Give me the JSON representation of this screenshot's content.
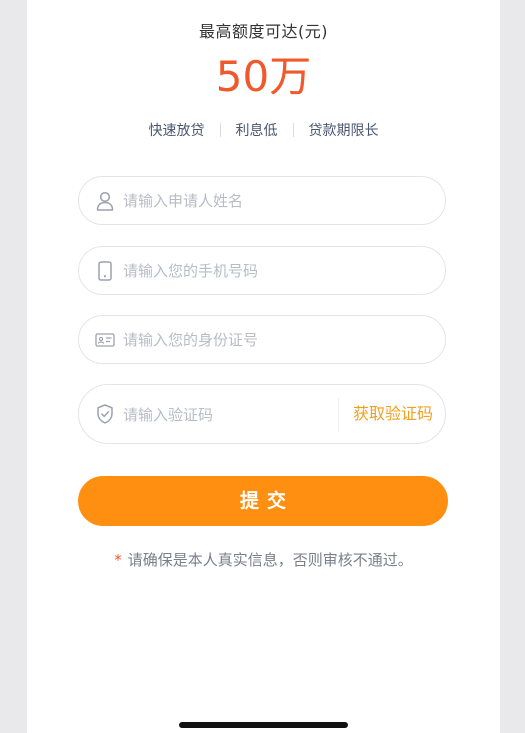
{
  "header": {
    "limit_label": "最高额度可达(元)",
    "limit_amount": "50万"
  },
  "features": [
    "快速放贷",
    "利息低",
    "贷款期限长"
  ],
  "form": {
    "name_placeholder": "请输入申请人姓名",
    "phone_placeholder": "请输入您的手机号码",
    "id_placeholder": "请输入您的身份证号",
    "code_placeholder": "请输入验证码",
    "get_code_label": "获取验证码",
    "submit_label": "提交"
  },
  "notice": {
    "star": "*",
    "text": "请确保是本人真实信息，否则审核不通过。"
  },
  "icons": {
    "name": "user-icon",
    "phone": "phone-icon",
    "id": "id-card-icon",
    "code": "shield-check-icon"
  },
  "colors": {
    "amount": "#f0592b",
    "submit": "#ff8f10",
    "get_code": "#f0a020"
  }
}
